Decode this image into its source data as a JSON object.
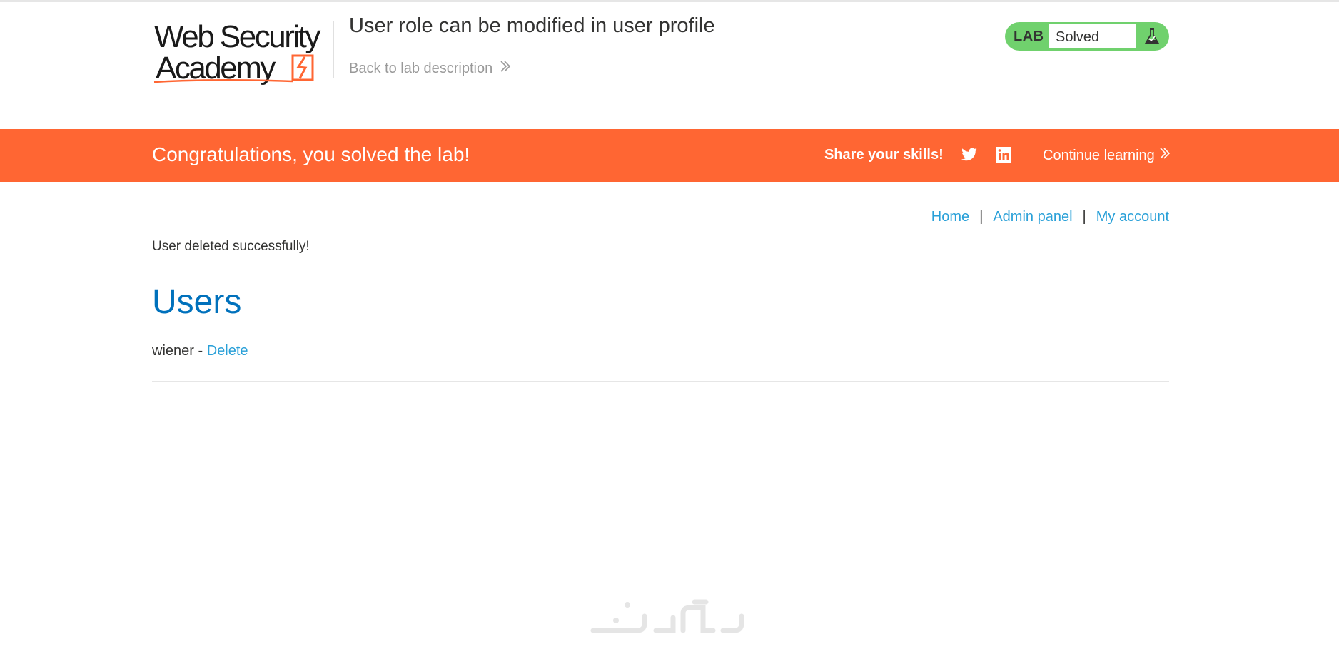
{
  "header": {
    "logo": {
      "line1": "Web Security",
      "line2": "Academy",
      "icon": "academy-lightning-icon",
      "accent": "#ff6633"
    },
    "lab_title": "User role can be modified in user profile",
    "back_link": "Back to lab description",
    "back_icon": "double-chevron-right-icon",
    "lab_status": {
      "badge": "LAB",
      "state": "Solved",
      "icon": "flask-icon",
      "color": "#70d16d"
    }
  },
  "banner": {
    "message": "Congratulations, you solved the lab!",
    "share_text": "Share your skills!",
    "social_icons": [
      "twitter-icon",
      "linkedin-icon"
    ],
    "continue_link": "Continue learning",
    "color": "#ff6633"
  },
  "nav": {
    "items": [
      {
        "label": "Home"
      },
      {
        "label": "Admin panel"
      },
      {
        "label": "My account"
      }
    ],
    "separator": "|"
  },
  "main": {
    "message": "User deleted successfully!",
    "heading": "Users",
    "users": [
      {
        "name": "wiener",
        "separator": " - ",
        "action": "Delete"
      }
    ]
  },
  "colors": {
    "link": "#29a0d8",
    "heading": "#0071bc",
    "text": "#333332"
  },
  "watermark": {
    "icon": "site-watermark-logo"
  }
}
